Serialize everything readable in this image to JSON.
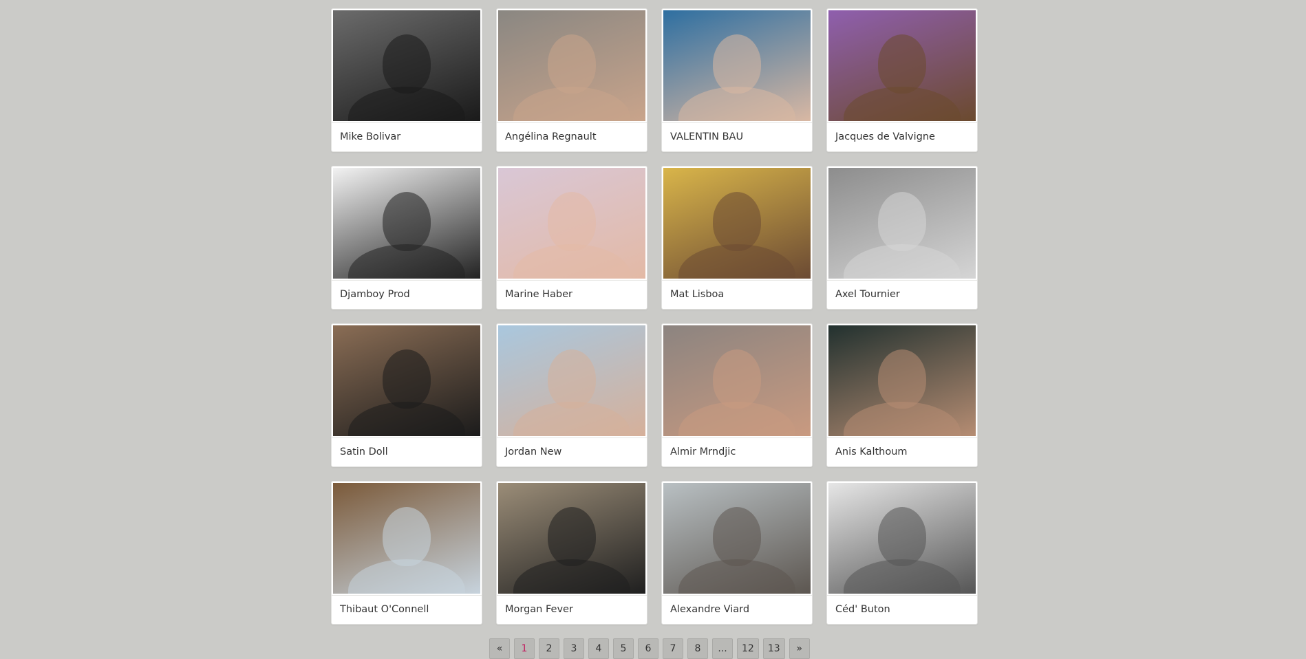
{
  "profiles": [
    {
      "name": "Mike Bolivar",
      "photo_bg": "#6b6b6b",
      "photo_fg": "#1a1a1a"
    },
    {
      "name": "Angélina Regnault",
      "photo_bg": "#8a8782",
      "photo_fg": "#c9a48b"
    },
    {
      "name": "VALENTIN BAU",
      "photo_bg": "#2e6fa1",
      "photo_fg": "#d9b8a3"
    },
    {
      "name": "Jacques de Valvigne",
      "photo_bg": "#8f5fae",
      "photo_fg": "#6b4a2e"
    },
    {
      "name": "Djamboy Prod",
      "photo_bg": "#f2f2f2",
      "photo_fg": "#222222"
    },
    {
      "name": "Marine Haber",
      "photo_bg": "#d9c7d6",
      "photo_fg": "#e3b9a5"
    },
    {
      "name": "Mat Lisboa",
      "photo_bg": "#d9b54a",
      "photo_fg": "#6b4a33"
    },
    {
      "name": "Axel Tournier",
      "photo_bg": "#8d8d8d",
      "photo_fg": "#d5d5d5"
    },
    {
      "name": "Satin Doll",
      "photo_bg": "#8a6d55",
      "photo_fg": "#1b1b1b"
    },
    {
      "name": "Jordan New",
      "photo_bg": "#a9c7de",
      "photo_fg": "#d6b09a"
    },
    {
      "name": "Almir Mrndjic",
      "photo_bg": "#8c8480",
      "photo_fg": "#c99a80"
    },
    {
      "name": "Anis Kalthoum",
      "photo_bg": "#22312f",
      "photo_fg": "#b68d73"
    },
    {
      "name": "Thibaut O'Connell",
      "photo_bg": "#7b5a3a",
      "photo_fg": "#c7d3dd"
    },
    {
      "name": "Morgan Fever",
      "photo_bg": "#9b8d78",
      "photo_fg": "#1f1f1f"
    },
    {
      "name": "Alexandre Viard",
      "photo_bg": "#b9c0c3",
      "photo_fg": "#5c5650"
    },
    {
      "name": "Céd' Buton",
      "photo_bg": "#e6e6e6",
      "photo_fg": "#555555"
    }
  ],
  "pagination": {
    "prev": "«",
    "pages": [
      "1",
      "2",
      "3",
      "4",
      "5",
      "6",
      "7",
      "8",
      "...",
      "12",
      "13"
    ],
    "next": "»",
    "current": "1"
  }
}
